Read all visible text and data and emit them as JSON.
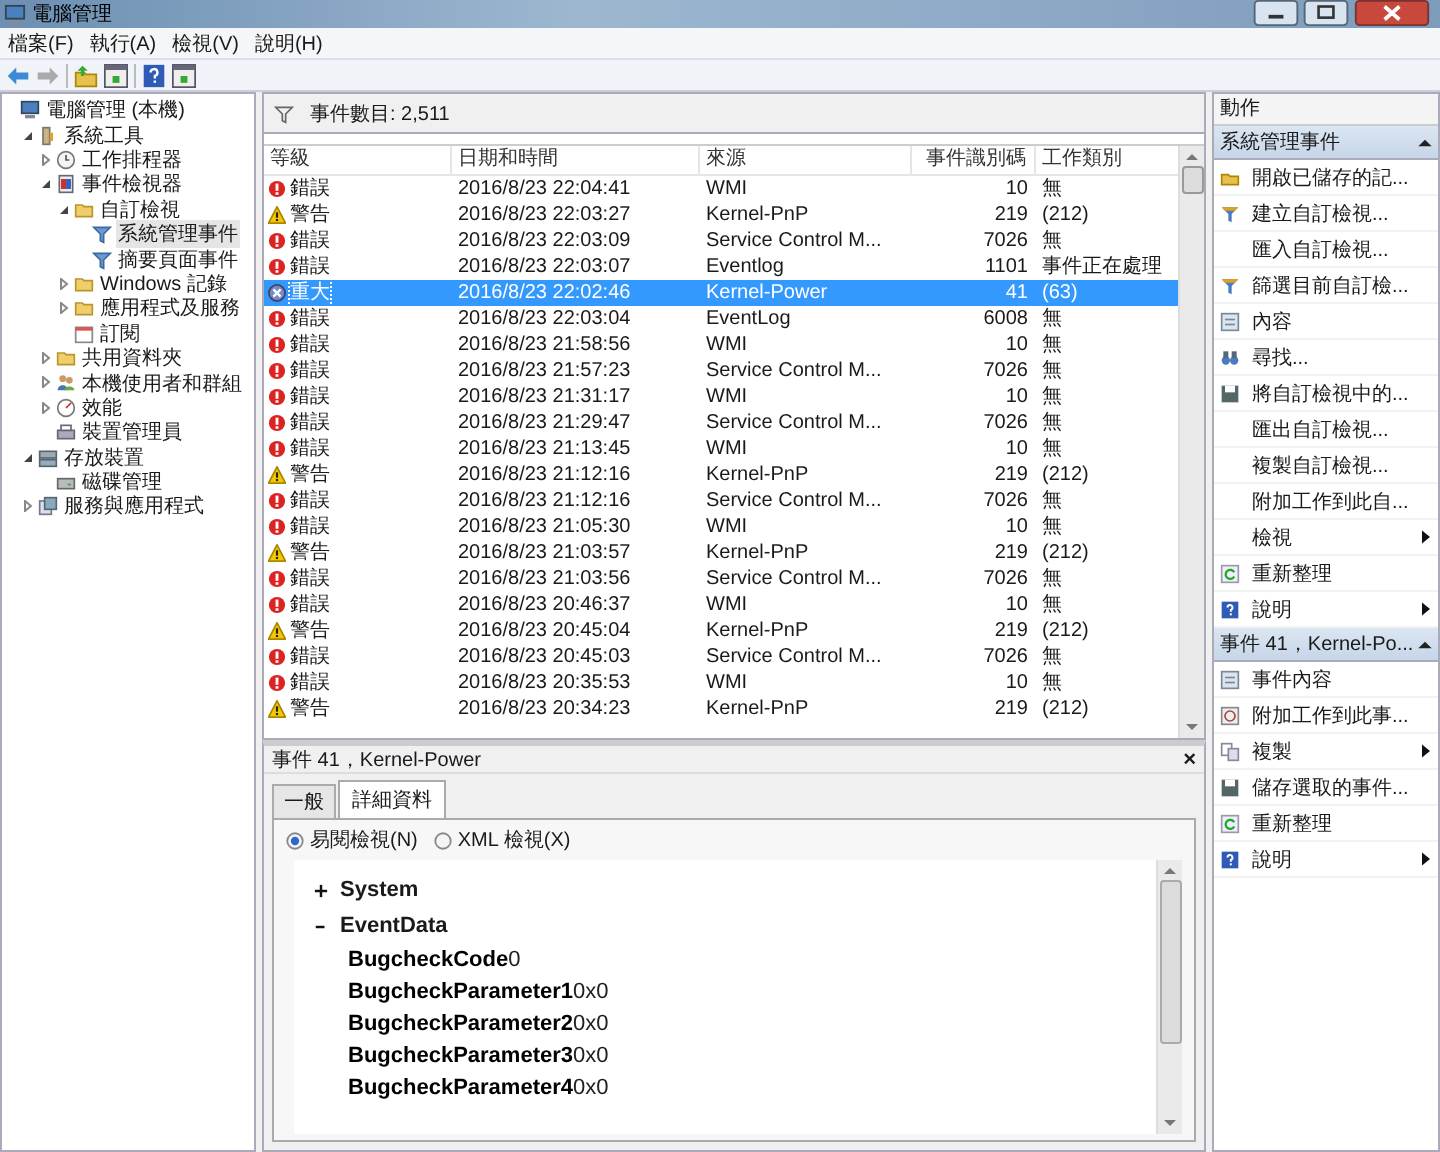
{
  "window": {
    "title": "電腦管理"
  },
  "menu": [
    "檔案(F)",
    "執行(A)",
    "檢視(V)",
    "說明(H)"
  ],
  "toolbar": [
    {
      "kind": "back",
      "disabled": false
    },
    {
      "kind": "forward",
      "disabled": true
    },
    {
      "kind": "up"
    },
    {
      "kind": "pane"
    },
    {
      "kind": "help"
    },
    {
      "kind": "pane"
    }
  ],
  "tree": [
    {
      "label": "電腦管理 (本機)",
      "kind": "computer",
      "selected": false,
      "children": [
        {
          "label": "系統工具",
          "kind": "tools",
          "expanded": true,
          "selected": false,
          "children": [
            {
              "label": "工作排程器",
              "kind": "clock",
              "expanded": false,
              "selected": false
            },
            {
              "label": "事件檢視器",
              "kind": "viewer",
              "expanded": true,
              "selected": false,
              "children": [
                {
                  "label": "自訂檢視",
                  "kind": "folder",
                  "expanded": true,
                  "selected": false,
                  "children": [
                    {
                      "label": "系統管理事件",
                      "kind": "filter",
                      "selected": true
                    },
                    {
                      "label": "摘要頁面事件",
                      "kind": "filter",
                      "selected": false
                    }
                  ]
                },
                {
                  "label": "Windows 記錄",
                  "kind": "folder",
                  "expanded": false,
                  "selected": false
                },
                {
                  "label": "應用程式及服務",
                  "kind": "folder",
                  "expanded": false,
                  "selected": false
                },
                {
                  "label": "訂閱",
                  "kind": "subscription",
                  "selected": false
                }
              ]
            },
            {
              "label": "共用資料夾",
              "kind": "folder",
              "expanded": false,
              "selected": false
            },
            {
              "label": "本機使用者和群組",
              "kind": "users",
              "expanded": false,
              "selected": false
            },
            {
              "label": "效能",
              "kind": "performance",
              "expanded": false,
              "selected": false
            },
            {
              "label": "裝置管理員",
              "kind": "device",
              "selected": false
            }
          ]
        },
        {
          "label": "存放裝置",
          "kind": "storage",
          "expanded": true,
          "selected": false,
          "children": [
            {
              "label": "磁碟管理",
              "kind": "disk",
              "selected": false
            }
          ]
        },
        {
          "label": "服務與應用程式",
          "kind": "services",
          "expanded": false,
          "selected": false
        }
      ]
    }
  ],
  "event_list": {
    "count_label": "事件數目: 2,511",
    "columns": [
      "等級",
      "日期和時間",
      "來源",
      "事件識別碼",
      "工作類別"
    ],
    "rows": [
      {
        "kind": "error",
        "level": "錯誤",
        "date": "2016/8/23 22:04:41",
        "source": "WMI",
        "id": "10",
        "category": "無",
        "selected": false
      },
      {
        "kind": "warning",
        "level": "警告",
        "date": "2016/8/23 22:03:27",
        "source": "Kernel-PnP",
        "id": "219",
        "category": "(212)",
        "selected": false
      },
      {
        "kind": "error",
        "level": "錯誤",
        "date": "2016/8/23 22:03:09",
        "source": "Service Control M...",
        "id": "7026",
        "category": "無",
        "selected": false
      },
      {
        "kind": "error",
        "level": "錯誤",
        "date": "2016/8/23 22:03:07",
        "source": "Eventlog",
        "id": "1101",
        "category": "事件正在處理",
        "selected": false
      },
      {
        "kind": "critical",
        "level": "重大",
        "date": "2016/8/23 22:02:46",
        "source": "Kernel-Power",
        "id": "41",
        "category": "(63)",
        "selected": true
      },
      {
        "kind": "error",
        "level": "錯誤",
        "date": "2016/8/23 22:03:04",
        "source": "EventLog",
        "id": "6008",
        "category": "無",
        "selected": false
      },
      {
        "kind": "error",
        "level": "錯誤",
        "date": "2016/8/23 21:58:56",
        "source": "WMI",
        "id": "10",
        "category": "無",
        "selected": false
      },
      {
        "kind": "error",
        "level": "錯誤",
        "date": "2016/8/23 21:57:23",
        "source": "Service Control M...",
        "id": "7026",
        "category": "無",
        "selected": false
      },
      {
        "kind": "error",
        "level": "錯誤",
        "date": "2016/8/23 21:31:17",
        "source": "WMI",
        "id": "10",
        "category": "無",
        "selected": false
      },
      {
        "kind": "error",
        "level": "錯誤",
        "date": "2016/8/23 21:29:47",
        "source": "Service Control M...",
        "id": "7026",
        "category": "無",
        "selected": false
      },
      {
        "kind": "error",
        "level": "錯誤",
        "date": "2016/8/23 21:13:45",
        "source": "WMI",
        "id": "10",
        "category": "無",
        "selected": false
      },
      {
        "kind": "warning",
        "level": "警告",
        "date": "2016/8/23 21:12:16",
        "source": "Kernel-PnP",
        "id": "219",
        "category": "(212)",
        "selected": false
      },
      {
        "kind": "error",
        "level": "錯誤",
        "date": "2016/8/23 21:12:16",
        "source": "Service Control M...",
        "id": "7026",
        "category": "無",
        "selected": false
      },
      {
        "kind": "error",
        "level": "錯誤",
        "date": "2016/8/23 21:05:30",
        "source": "WMI",
        "id": "10",
        "category": "無",
        "selected": false
      },
      {
        "kind": "warning",
        "level": "警告",
        "date": "2016/8/23 21:03:57",
        "source": "Kernel-PnP",
        "id": "219",
        "category": "(212)",
        "selected": false
      },
      {
        "kind": "error",
        "level": "錯誤",
        "date": "2016/8/23 21:03:56",
        "source": "Service Control M...",
        "id": "7026",
        "category": "無",
        "selected": false
      },
      {
        "kind": "error",
        "level": "錯誤",
        "date": "2016/8/23 20:46:37",
        "source": "WMI",
        "id": "10",
        "category": "無",
        "selected": false
      },
      {
        "kind": "warning",
        "level": "警告",
        "date": "2016/8/23 20:45:04",
        "source": "Kernel-PnP",
        "id": "219",
        "category": "(212)",
        "selected": false
      },
      {
        "kind": "error",
        "level": "錯誤",
        "date": "2016/8/23 20:45:03",
        "source": "Service Control M...",
        "id": "7026",
        "category": "無",
        "selected": false
      },
      {
        "kind": "error",
        "level": "錯誤",
        "date": "2016/8/23 20:35:53",
        "source": "WMI",
        "id": "10",
        "category": "無",
        "selected": false
      },
      {
        "kind": "warning",
        "level": "警告",
        "date": "2016/8/23 20:34:23",
        "source": "Kernel-PnP",
        "id": "219",
        "category": "(212)",
        "selected": false
      }
    ]
  },
  "detail": {
    "title": "事件 41，Kernel-Power",
    "close": "×",
    "tabs": [
      {
        "label": "一般",
        "selected": false
      },
      {
        "label": "詳細資料",
        "selected": true
      }
    ],
    "views": [
      {
        "label": "易閱檢視(N)",
        "selected": true
      },
      {
        "label": "XML 檢視(X)",
        "selected": false
      }
    ],
    "sections": [
      {
        "label": "System",
        "expanded": false
      },
      {
        "label": "EventData",
        "expanded": true,
        "fields": [
          {
            "name": "BugcheckCode",
            "value": "0"
          },
          {
            "name": "BugcheckParameter1",
            "value": "0x0"
          },
          {
            "name": "BugcheckParameter2",
            "value": "0x0"
          },
          {
            "name": "BugcheckParameter3",
            "value": "0x0"
          },
          {
            "name": "BugcheckParameter4",
            "value": "0x0"
          }
        ]
      }
    ]
  },
  "actions": {
    "title": "動作",
    "groups": [
      {
        "title": "系統管理事件",
        "expanded": true,
        "items": [
          {
            "label": "開啟已儲存的記...",
            "kind": "open",
            "submenu": false
          },
          {
            "label": "建立自訂檢視...",
            "kind": "filter",
            "submenu": false
          },
          {
            "label": "匯入自訂檢視...",
            "kind": "plain",
            "submenu": false
          },
          {
            "label": "篩選目前自訂檢...",
            "kind": "filter",
            "submenu": false
          },
          {
            "label": "內容",
            "kind": "properties",
            "submenu": false
          },
          {
            "label": "尋找...",
            "kind": "find",
            "submenu": false
          },
          {
            "label": "將自訂檢視中的...",
            "kind": "save",
            "submenu": false
          },
          {
            "label": "匯出自訂檢視...",
            "kind": "plain",
            "submenu": false
          },
          {
            "label": "複製自訂檢視...",
            "kind": "plain",
            "submenu": false
          },
          {
            "label": "附加工作到此自...",
            "kind": "plain",
            "submenu": false
          },
          {
            "label": "檢視",
            "kind": "plain",
            "submenu": true
          },
          {
            "label": "重新整理",
            "kind": "refresh",
            "submenu": false
          },
          {
            "label": "說明",
            "kind": "help",
            "submenu": true
          }
        ]
      },
      {
        "title": "事件 41，Kernel-Po...",
        "expanded": true,
        "items": [
          {
            "label": "事件內容",
            "kind": "properties",
            "submenu": false
          },
          {
            "label": "附加工作到此事...",
            "kind": "task",
            "submenu": false
          },
          {
            "label": "複製",
            "kind": "copy",
            "submenu": true
          },
          {
            "label": "儲存選取的事件...",
            "kind": "save",
            "submenu": false
          },
          {
            "label": "重新整理",
            "kind": "refresh",
            "submenu": false
          },
          {
            "label": "說明",
            "kind": "help",
            "submenu": true
          }
        ]
      }
    ]
  }
}
